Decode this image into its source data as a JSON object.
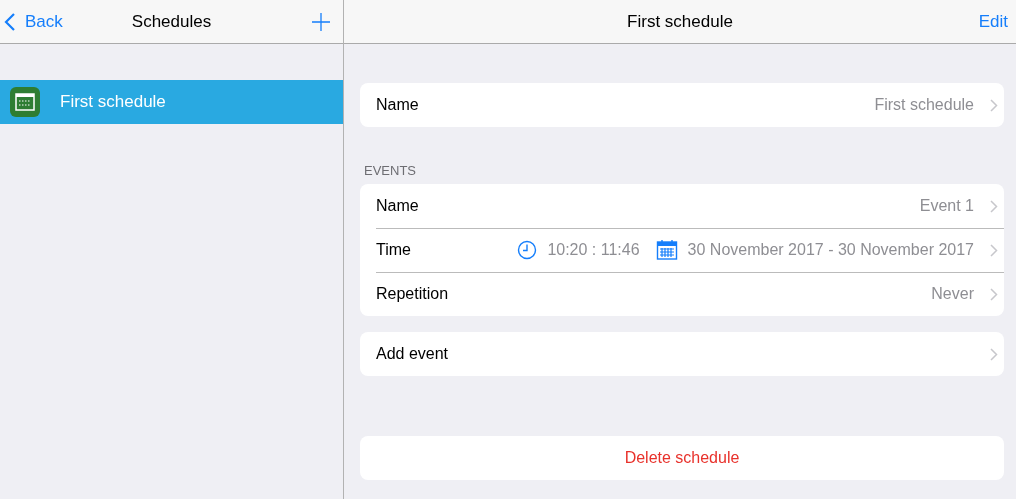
{
  "sidebar": {
    "back": "Back",
    "title": "Schedules",
    "items": [
      {
        "label": "First schedule",
        "selected": true
      }
    ]
  },
  "detail": {
    "title": "First schedule",
    "edit": "Edit",
    "name_row": {
      "label": "Name",
      "value": "First schedule"
    },
    "events_header": "EVENTS",
    "events": [
      {
        "kind": "value",
        "label": "Name",
        "value": "Event 1"
      },
      {
        "kind": "time",
        "label": "Time",
        "time": "10:20 : 11:46",
        "dates": "30 November 2017 - 30 November 2017"
      },
      {
        "kind": "value",
        "label": "Repetition",
        "value": "Never"
      }
    ],
    "add_event": "Add event",
    "delete": "Delete schedule"
  }
}
